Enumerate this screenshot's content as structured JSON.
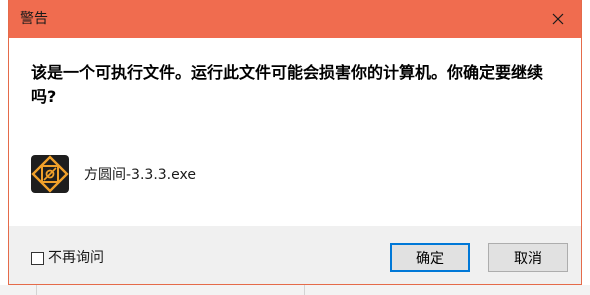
{
  "dialog": {
    "title": "警告",
    "message": "该是一个可执行文件。运行此文件可能会损害你的计算机。你确定要继续吗?",
    "file_name": "方圆间-3.3.3.exe",
    "file_icon": "app-logo-icon",
    "close_icon": "close-icon",
    "checkbox_label": "不再询问",
    "checkbox_checked": false,
    "ok_label": "确定",
    "cancel_label": "取消"
  },
  "colors": {
    "titlebar": "#f06c4f",
    "border": "#e56b4a",
    "focus_button": "#0078d7",
    "body": "#ffffff",
    "footer": "#f0f0f0"
  }
}
